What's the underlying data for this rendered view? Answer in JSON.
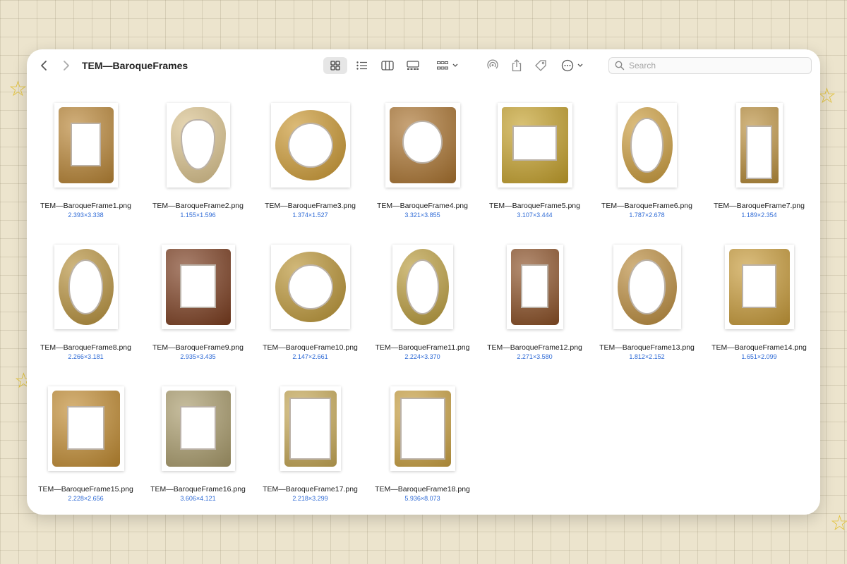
{
  "window": {
    "title": "TEM—BaroqueFrames"
  },
  "toolbar": {
    "back_icon": "chevron-left-icon",
    "forward_icon": "chevron-right-icon",
    "view_icons": [
      "icon-grid-icon",
      "list-icon",
      "columns-icon",
      "gallery-icon"
    ],
    "group_icon": "group-grid-icon",
    "airdrop_icon": "airdrop-icon",
    "share_icon": "share-icon",
    "tag_icon": "tag-icon",
    "more_icon": "ellipsis-circle-icon",
    "search_placeholder": "Search"
  },
  "colors": {
    "accent_dim": "#2f6bd6",
    "gold": "#c99a3a",
    "dark_wood": "#7a3c1e",
    "brass": "#b89a4a"
  },
  "files": [
    {
      "name": "TEM—BaroqueFrame1.png",
      "dims": "2.393×3.338",
      "color": "#b88434",
      "shape": "rect"
    },
    {
      "name": "TEM—BaroqueFrame2.png",
      "dims": "1.155×1.596",
      "color": "#d8c08a",
      "shape": "heart"
    },
    {
      "name": "TEM—BaroqueFrame3.png",
      "dims": "1.374×1.527",
      "color": "#c9962f",
      "shape": "circle"
    },
    {
      "name": "TEM—BaroqueFrame4.png",
      "dims": "3.321×3.855",
      "color": "#a9722e",
      "shape": "oval-in-rect"
    },
    {
      "name": "TEM—BaroqueFrame5.png",
      "dims": "3.107×3.444",
      "color": "#c4a02a",
      "shape": "rect-wide"
    },
    {
      "name": "TEM—BaroqueFrame6.png",
      "dims": "1.787×2.678",
      "color": "#c99a3a",
      "shape": "oval"
    },
    {
      "name": "TEM—BaroqueFrame7.png",
      "dims": "1.189×2.354",
      "color": "#b98e3c",
      "shape": "tall"
    },
    {
      "name": "TEM—BaroqueFrame8.png",
      "dims": "2.266×3.181",
      "color": "#b58f3a",
      "shape": "oval"
    },
    {
      "name": "TEM—BaroqueFrame9.png",
      "dims": "2.935×3.435",
      "color": "#7a3c1e",
      "shape": "rect"
    },
    {
      "name": "TEM—BaroqueFrame10.png",
      "dims": "2.147×2.661",
      "color": "#b89232",
      "shape": "circle"
    },
    {
      "name": "TEM—BaroqueFrame11.png",
      "dims": "2.224×3.370",
      "color": "#b89a3a",
      "shape": "oval"
    },
    {
      "name": "TEM—BaroqueFrame12.png",
      "dims": "2.271×3.580",
      "color": "#8a4f25",
      "shape": "rect"
    },
    {
      "name": "TEM—BaroqueFrame13.png",
      "dims": "1.812×2.152",
      "color": "#b8893a",
      "shape": "oval"
    },
    {
      "name": "TEM—BaroqueFrame14.png",
      "dims": "1.651×2.099",
      "color": "#c79a38",
      "shape": "rect"
    },
    {
      "name": "TEM—BaroqueFrame15.png",
      "dims": "2.228×2.656",
      "color": "#c08a30",
      "shape": "rect"
    },
    {
      "name": "TEM—BaroqueFrame16.png",
      "dims": "3.606×4.121",
      "color": "#a89a6a",
      "shape": "rect"
    },
    {
      "name": "TEM—BaroqueFrame17.png",
      "dims": "2.218×3.299",
      "color": "#c6a855",
      "shape": "rect-thin"
    },
    {
      "name": "TEM—BaroqueFrame18.png",
      "dims": "5.936×8.073",
      "color": "#caa142",
      "shape": "rect-thin"
    }
  ]
}
